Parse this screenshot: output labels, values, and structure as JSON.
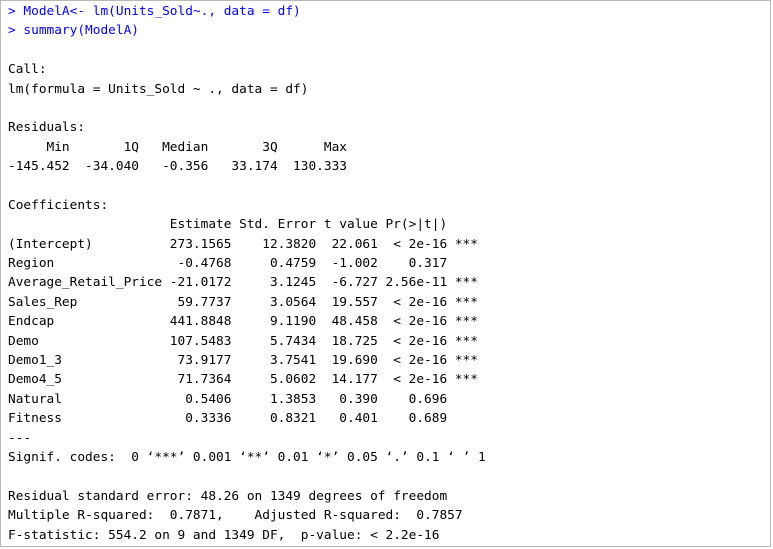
{
  "commands": [
    "> ModelA<- lm(Units_Sold~., data = df)",
    "> summary(ModelA)"
  ],
  "call": {
    "label": "Call:",
    "formula": "lm(formula = Units_Sold ~ ., data = df)"
  },
  "residuals": {
    "label": "Residuals:",
    "header": "     Min       1Q   Median       3Q      Max ",
    "values": "-145.452  -34.040   -0.356   33.174  130.333 "
  },
  "coefficients": {
    "label": "Coefficients:",
    "header": "                     Estimate Std. Error t value Pr(>|t|)    ",
    "rows": [
      "(Intercept)          273.1565    12.3820  22.061  < 2e-16 ***",
      "Region                -0.4768     0.4759  -1.002    0.317    ",
      "Average_Retail_Price -21.0172     3.1245  -6.727 2.56e-11 ***",
      "Sales_Rep             59.7737     3.0564  19.557  < 2e-16 ***",
      "Endcap               441.8848     9.1190  48.458  < 2e-16 ***",
      "Demo                 107.5483     5.7434  18.725  < 2e-16 ***",
      "Demo1_3               73.9177     3.7541  19.690  < 2e-16 ***",
      "Demo4_5               71.7364     5.0602  14.177  < 2e-16 ***",
      "Natural                0.5406     1.3853   0.390    0.696    ",
      "Fitness                0.3336     0.8321   0.401    0.689    "
    ],
    "separator": "---",
    "signif": "Signif. codes:  0 ‘***’ 0.001 ‘**’ 0.01 ‘*’ 0.05 ‘.’ 0.1 ‘ ’ 1"
  },
  "stats": [
    "Residual standard error: 48.26 on 1349 degrees of freedom",
    "Multiple R-squared:  0.7871,\tAdjusted R-squared:  0.7857 ",
    "F-statistic: 554.2 on 9 and 1349 DF,  p-value: < 2.2e-16"
  ],
  "colors": {
    "command": "#0000ff",
    "output": "#000000",
    "background": "#ffffff"
  }
}
